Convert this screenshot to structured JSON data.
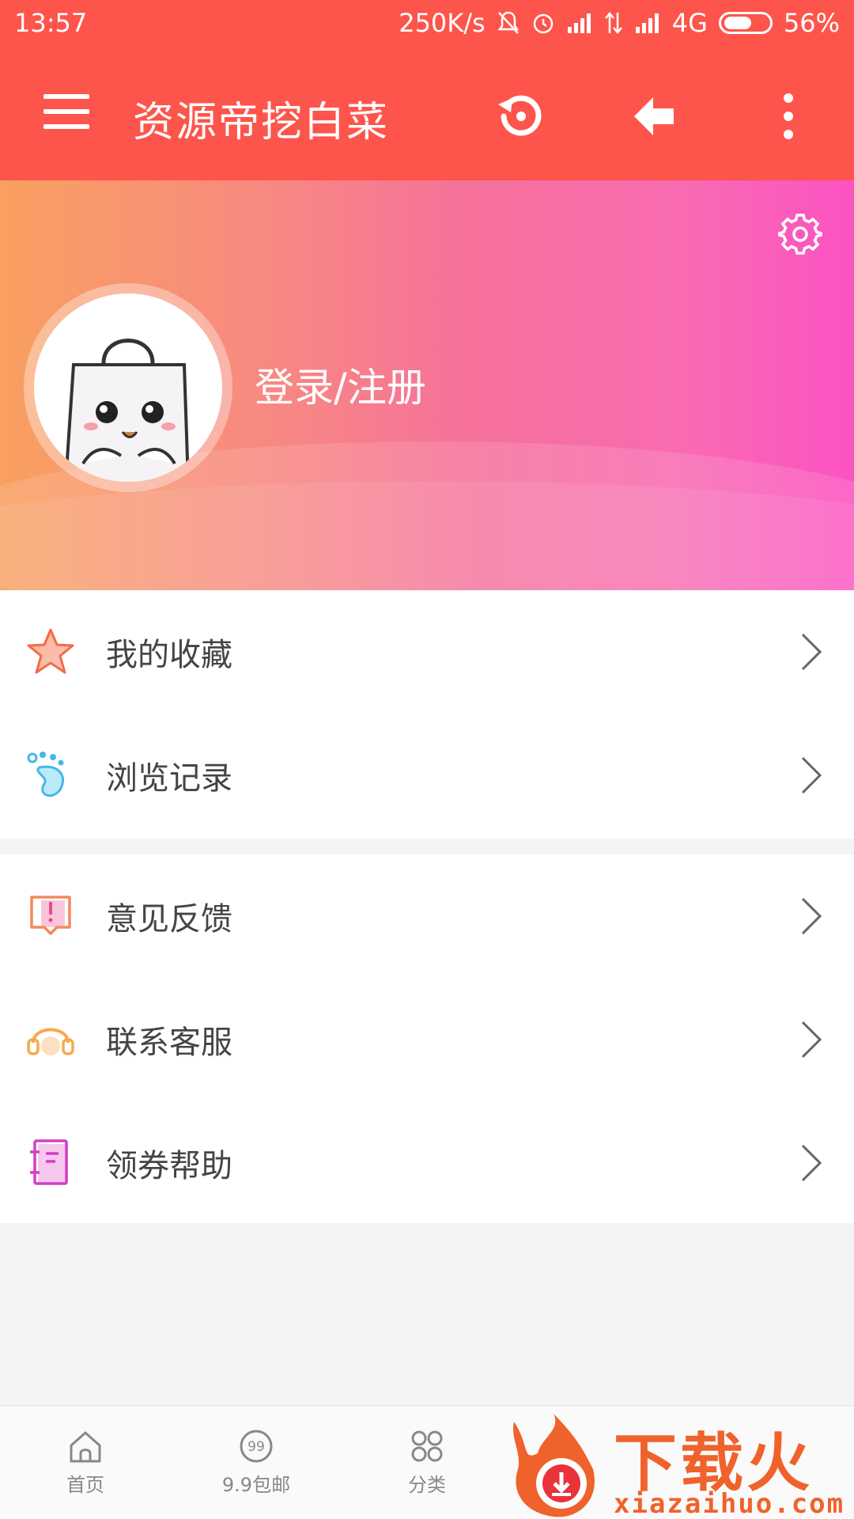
{
  "status_bar": {
    "time": "13:57",
    "net_speed": "250K/s",
    "network": "4G",
    "battery": "56%"
  },
  "app_bar": {
    "title": "资源帝挖白菜",
    "icons": [
      "menu-icon",
      "history-icon",
      "back-arrow-icon",
      "more-vertical-icon"
    ]
  },
  "profile": {
    "login_label": "登录/注册",
    "gradient_colors": [
      "#f9a060",
      "#fc52c2"
    ]
  },
  "menu_groups": [
    [
      {
        "label": "我的收藏",
        "icon": "star-icon"
      },
      {
        "label": "浏览记录",
        "icon": "footprint-icon"
      }
    ],
    [
      {
        "label": "意见反馈",
        "icon": "feedback-icon"
      },
      {
        "label": "联系客服",
        "icon": "headset-icon"
      },
      {
        "label": "领券帮助",
        "icon": "notebook-icon"
      }
    ]
  ],
  "bottom_nav": {
    "tabs": [
      {
        "label": "首页",
        "icon": "home-icon"
      },
      {
        "label": "9.9包邮",
        "icon": "nine-nine-icon"
      },
      {
        "label": "分类",
        "icon": "category-icon"
      }
    ],
    "watermark": {
      "text": "下载火",
      "url": "xiazaihuo.com"
    }
  },
  "colors": {
    "primary": "#fd554b",
    "text": "#444444",
    "background": "#f4f4f4"
  }
}
